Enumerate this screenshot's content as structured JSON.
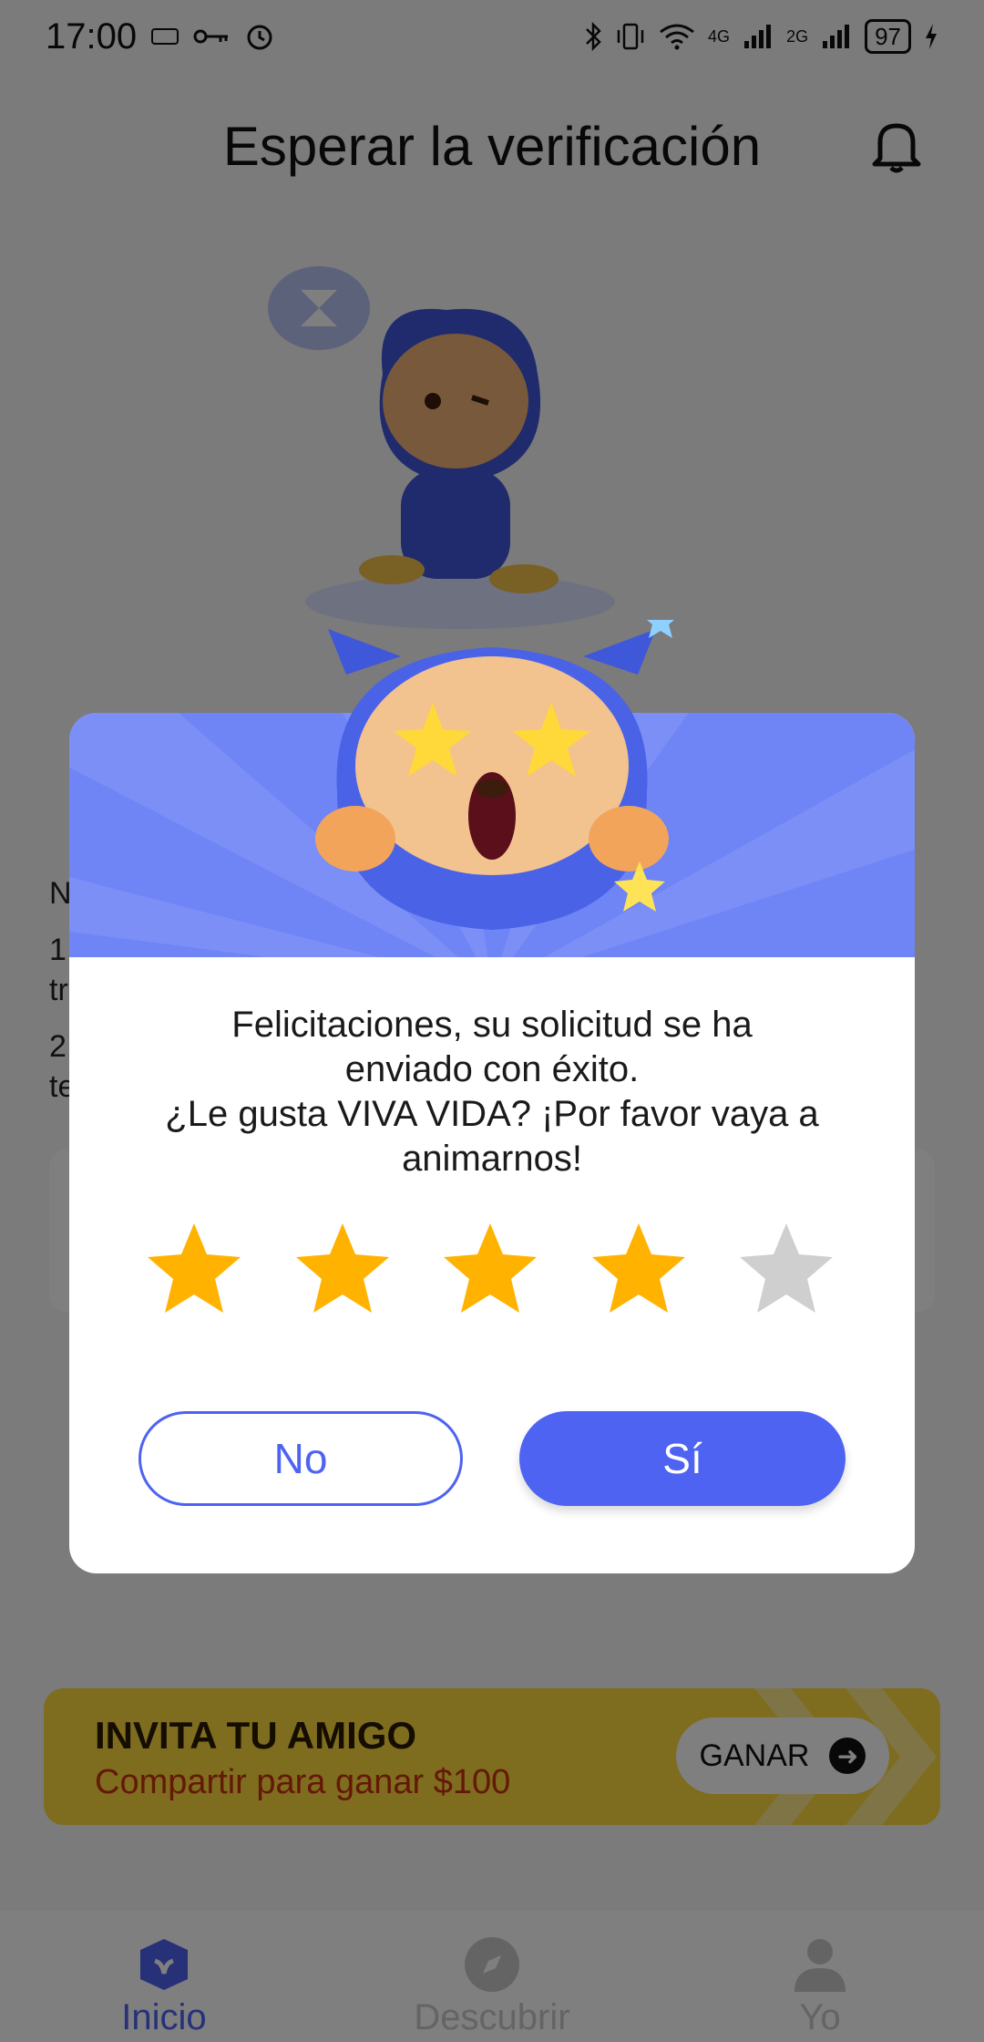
{
  "status_bar": {
    "time": "17:00",
    "network_4g": "4G",
    "network_2g": "2G",
    "battery": "97"
  },
  "header": {
    "title": "Esperar la verificación"
  },
  "background_text": {
    "line_1": "N",
    "line_2a": "1",
    "line_2b": "tr",
    "line_3a": "2",
    "line_3b": "te"
  },
  "invite": {
    "title": "INVITA TU AMIGO",
    "subtitle": "Compartir para ganar $100",
    "button_label": "GANAR"
  },
  "nav": {
    "items": [
      {
        "label": "Inicio",
        "icon": "home-icon"
      },
      {
        "label": "Descubrir",
        "icon": "compass-icon"
      },
      {
        "label": "Yo",
        "icon": "person-icon"
      }
    ],
    "active": "Inicio"
  },
  "dialog": {
    "message_line_1": "Felicitaciones, su solicitud se ha",
    "message_line_2": "enviado con éxito.",
    "message_line_3": "¿Le gusta VIVA VIDA? ¡Por favor vaya a",
    "message_line_4": "animarnos!",
    "rating": 4,
    "max_rating": 5,
    "no_label": "No",
    "yes_label": "Sí"
  },
  "colors": {
    "accent": "#4e63f1",
    "banner": "#6f84f5",
    "star_filled": "#ffb300",
    "star_empty": "#cfcfcf",
    "invite_bg": "#fcd93f"
  }
}
